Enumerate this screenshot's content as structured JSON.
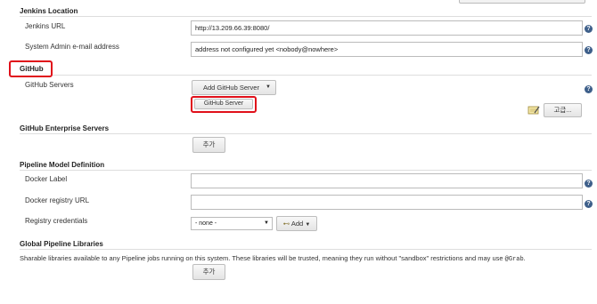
{
  "jenkins_location": {
    "title": "Jenkins Location",
    "url_label": "Jenkins URL",
    "url_value": "http://13.209.66.39:8080/",
    "email_label": "System Admin e-mail address",
    "email_value": "address not configured yet <nobody@nowhere>"
  },
  "github": {
    "title": "GitHub",
    "servers_label": "GitHub Servers",
    "add_button": "Add GitHub Server",
    "dropdown_item": "GitHub Server",
    "advanced_button": "고급..."
  },
  "github_enterprise": {
    "title": "GitHub Enterprise Servers",
    "add_button": "추가"
  },
  "pipeline_model": {
    "title": "Pipeline Model Definition",
    "docker_label": "Docker Label",
    "docker_label_value": "",
    "registry_url_label": "Docker registry URL",
    "registry_url_value": "",
    "credentials_label": "Registry credentials",
    "credentials_selected": "- none -",
    "add_button": "Add"
  },
  "global_libs": {
    "title": "Global Pipeline Libraries",
    "description_pre": "Sharable libraries available to any Pipeline jobs running on this system. These libraries will be trusted, meaning they run without \"sandbox\" restrictions and may use ",
    "description_code": "@Grab",
    "description_post": ".",
    "add_button": "추가"
  },
  "help_glyph": "?",
  "colors": {
    "highlight": "#e0101a",
    "help": "#3e5f8a"
  }
}
